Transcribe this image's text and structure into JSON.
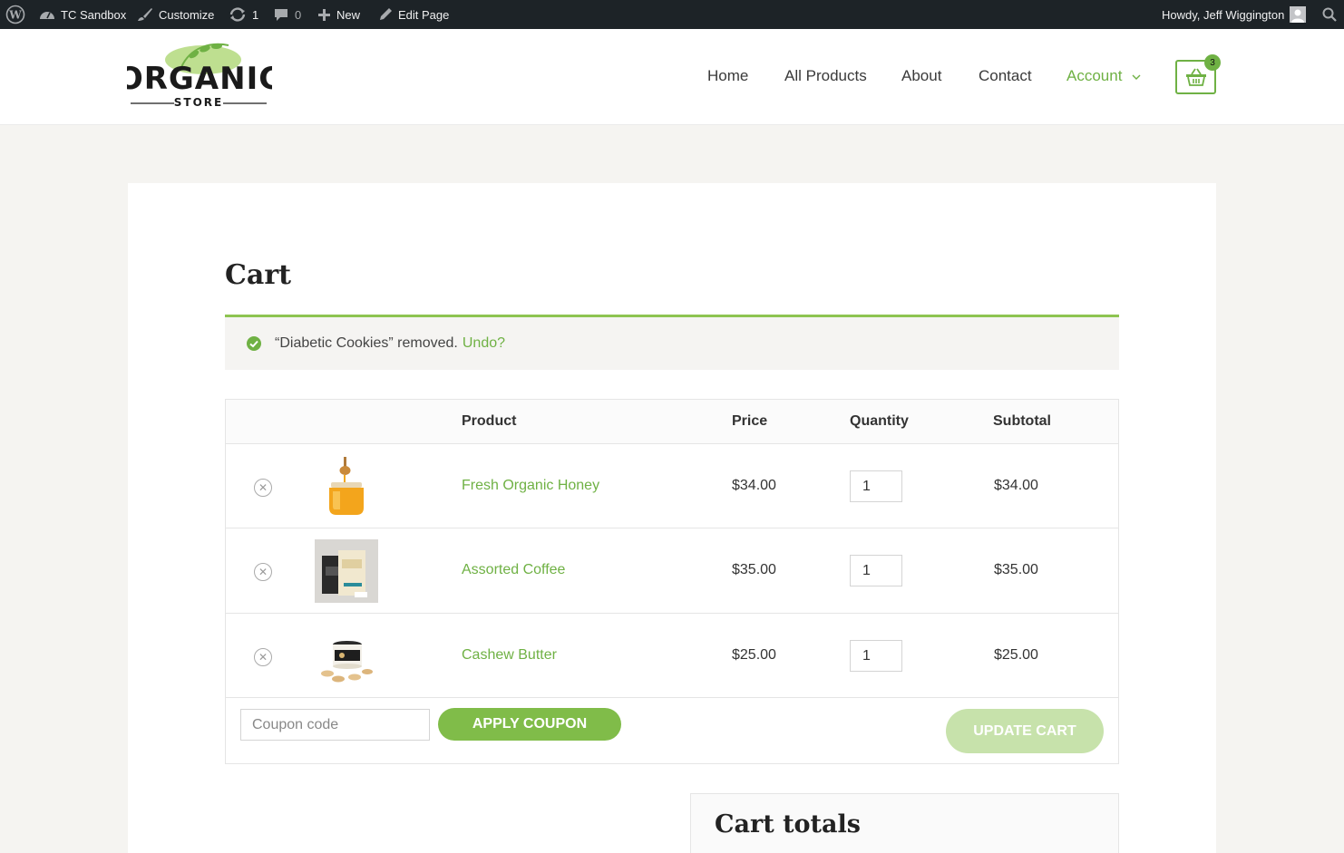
{
  "adminbar": {
    "site_name": "TC Sandbox",
    "customize": "Customize",
    "updates_count": "1",
    "comments_count": "0",
    "new_label": "New",
    "edit_page": "Edit Page",
    "greeting": "Howdy, Jeff Wiggington"
  },
  "header": {
    "logo_text": "ORGANIC",
    "logo_subtext": "STORE",
    "nav": [
      "Home",
      "All Products",
      "About",
      "Contact",
      "Account"
    ],
    "cart_count": "3",
    "accent_color": "#6fb144"
  },
  "page": {
    "title": "Cart",
    "notice": {
      "message": "“Diabetic Cookies” removed.",
      "undo_link": "Undo?"
    }
  },
  "cart": {
    "headers": {
      "product": "Product",
      "price": "Price",
      "quantity": "Quantity",
      "subtotal": "Subtotal"
    },
    "items": [
      {
        "name": "Fresh Organic Honey",
        "price": "$34.00",
        "quantity": "1",
        "subtotal": "$34.00",
        "image": "honey-jar"
      },
      {
        "name": "Assorted Coffee",
        "price": "$35.00",
        "quantity": "1",
        "subtotal": "$35.00",
        "image": "coffee-bags"
      },
      {
        "name": "Cashew Butter",
        "price": "$25.00",
        "quantity": "1",
        "subtotal": "$25.00",
        "image": "cashew-butter-jar"
      }
    ],
    "coupon_placeholder": "Coupon code",
    "apply_coupon_label": "APPLY COUPON",
    "update_cart_label": "UPDATE CART"
  },
  "totals": {
    "title": "Cart totals"
  }
}
